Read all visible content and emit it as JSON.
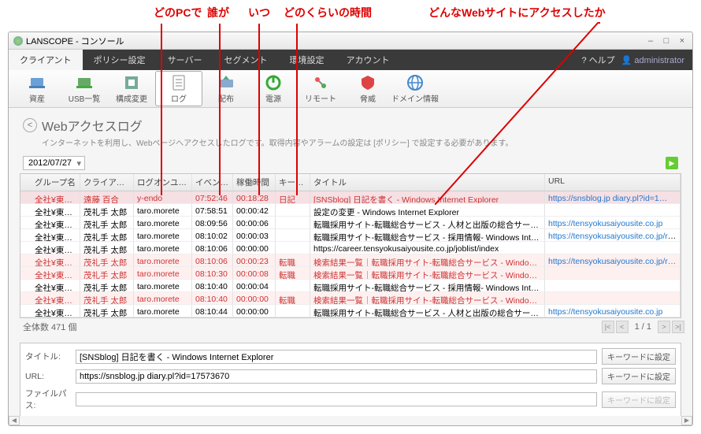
{
  "callouts": {
    "pc": "どのPCで",
    "who": "誰が",
    "when": "いつ",
    "dur": "どのくらいの時間",
    "site": "どんなWebサイトにアクセスしたか"
  },
  "window": {
    "title": "LANSCOPE - コンソール",
    "help": "ヘルプ",
    "user": "administrator"
  },
  "mainTabs": [
    "クライアント",
    "ポリシー設定",
    "サーバー",
    "セグメント",
    "環境設定",
    "アカウント"
  ],
  "tools": [
    {
      "name": "asset",
      "label": "資産"
    },
    {
      "name": "usb",
      "label": "USB一覧"
    },
    {
      "name": "config",
      "label": "構成変更"
    },
    {
      "name": "log",
      "label": "ログ",
      "active": true
    },
    {
      "name": "deploy",
      "label": "配布"
    },
    {
      "name": "power",
      "label": "電源"
    },
    {
      "name": "remote",
      "label": "リモート"
    },
    {
      "name": "threat",
      "label": "脅威"
    },
    {
      "name": "domain",
      "label": "ドメイン情報"
    }
  ],
  "page": {
    "title": "Webアクセスログ",
    "desc": "インターネットを利用し、Webページへアクセスしたログです。取得内容やアラームの設定は [ポリシー] で設定する必要があります。"
  },
  "dateFilter": "2012/07/27",
  "columns": {
    "group": "グループ名",
    "client": "クライアント名",
    "user": "ログオンユーザ…",
    "time": "イベント時刻",
    "dur": "稼働時間",
    "kw": "キーワード",
    "title": "タイトル",
    "url": "URL"
  },
  "rows": [
    {
      "hl": true,
      "sel": true,
      "group": "全社¥東京本部…",
      "client": "遠藤 百合",
      "user": "y-endo",
      "time": "07:52:46",
      "dur": "00:18:28",
      "kw": "日記",
      "title": "[SNSblog] 日記を書く - Windows Internet Explorer",
      "url": "https://snsblog.jp diary.pl?id=1…"
    },
    {
      "hl": false,
      "group": "全社¥東京本部…",
      "client": "茂礼手 太郎",
      "user": "taro.morete",
      "time": "07:58:51",
      "dur": "00:00:42",
      "kw": "",
      "title": "設定の変更 - Windows Internet Explorer",
      "url": ""
    },
    {
      "hl": false,
      "group": "全社¥東京本部…",
      "client": "茂礼手 太郎",
      "user": "taro.morete",
      "time": "08:09:56",
      "dur": "00:00:06",
      "kw": "",
      "title": "転職採用サイト-転職総合サービス - 人材と出版の総合サービス企業 - Windows Int",
      "url": "https://tensyokusaiyousite.co.jp"
    },
    {
      "hl": false,
      "group": "全社¥東京本部…",
      "client": "茂礼手 太郎",
      "user": "taro.morete",
      "time": "08:10:02",
      "dur": "00:00:03",
      "kw": "",
      "title": "転職採用サイト-転職総合サービス - 採用情報- Windows Internet Explorer",
      "url": "https://tensyokusaiyousite.co.jp/re…"
    },
    {
      "hl": false,
      "group": "全社¥東京本部…",
      "client": "茂礼手 太郎",
      "user": "taro.morete",
      "time": "08:10:06",
      "dur": "00:00:00",
      "kw": "",
      "title": "https://career.tensyokusaiyousite.co.jp/joblist/index",
      "url": ""
    },
    {
      "hl": true,
      "group": "全社¥東京本部…",
      "client": "茂礼手 太郎",
      "user": "taro.morete",
      "time": "08:10:06",
      "dur": "00:00:23",
      "kw": "転職",
      "title": "検索結果一覧｜転職採用サイト-転職総合サービス - Windows Internet Explo",
      "url": "https://tensyokusaiyousite.co.jp/re…"
    },
    {
      "hl": true,
      "group": "全社¥東京本部…",
      "client": "茂礼手 太郎",
      "user": "taro.morete",
      "time": "08:10:30",
      "dur": "00:00:08",
      "kw": "転職",
      "title": "検索結果一覧｜転職採用サイト-転職総合サービス - Windows Internet Explo",
      "url": ""
    },
    {
      "hl": false,
      "group": "全社¥東京本部…",
      "client": "茂礼手 太郎",
      "user": "taro.morete",
      "time": "08:10:40",
      "dur": "00:00:04",
      "kw": "",
      "title": "転職採用サイト-転職総合サービス - 採用情報- Windows Internet Explorer",
      "url": ""
    },
    {
      "hl": true,
      "group": "全社¥東京本部…",
      "client": "茂礼手 太郎",
      "user": "taro.morete",
      "time": "08:10:40",
      "dur": "00:00:00",
      "kw": "転職",
      "title": "検索結果一覧｜転職採用サイト-転職総合サービス - Windows Internet Explo",
      "url": ""
    },
    {
      "hl": false,
      "group": "全社¥東京本部…",
      "client": "茂礼手 太郎",
      "user": "taro.morete",
      "time": "08:10:44",
      "dur": "00:00:00",
      "kw": "",
      "title": "転職採用サイト-転職総合サービス - 人材と出版の総合サービス企業 - Windows Int",
      "url": "https://tensyokusaiyousite.co.jp"
    }
  ],
  "status": {
    "total": "全体数 471 個",
    "page": "1 / 1"
  },
  "detail": {
    "title_label": "タイトル:",
    "title_value": "[SNSblog] 日記を書く - Windows Internet Explorer",
    "url_label": "URL:",
    "url_value": "https://snsblog.jp diary.pl?id=17573670",
    "path_label": "ファイルパス:",
    "path_value": "",
    "assign": "キーワードに設定"
  }
}
